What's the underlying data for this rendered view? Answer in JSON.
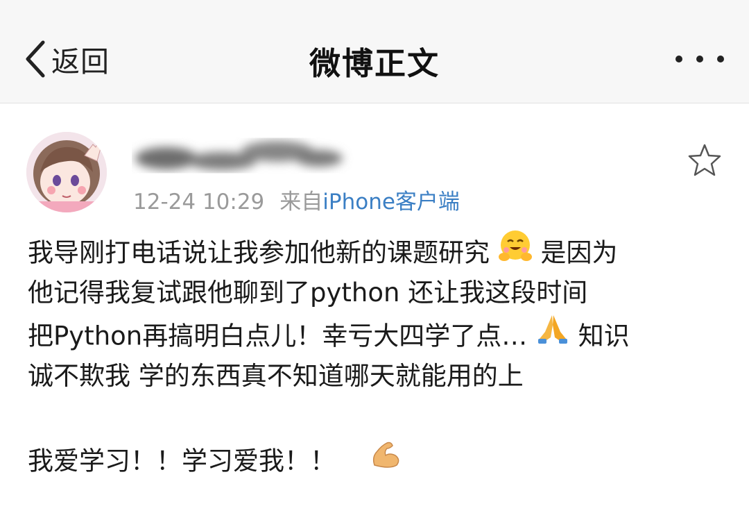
{
  "nav": {
    "back_label": "返回",
    "title": "微博正文"
  },
  "post": {
    "time": "12-24 10:29",
    "source_prefix": "来自",
    "source_link": "iPhone客户端",
    "lines": [
      [
        "我导刚打电话说让我参加他新的课题研究",
        "是因为"
      ],
      [
        "他记得我复试跟他聊到了python  还让我这段时间"
      ],
      [
        "把Python再搞明白点儿！幸亏大四学了点…",
        "知识"
      ],
      [
        "诚不欺我  学的东西真不知道哪天就能用的上"
      ],
      [
        "我爱学习！！学习爱我！！"
      ]
    ]
  },
  "icons": {
    "back": "chevron-left-icon",
    "more": "more-dots-icon",
    "favorite": "star-outline-icon",
    "emoji_1": "hugging-face-emoji",
    "emoji_2": "folded-hands-emoji",
    "emoji_3": "flexed-biceps-emoji"
  },
  "colors": {
    "link": "#3b7fc4",
    "meta": "#9a9a9a",
    "nav_bg": "#f7f7f7"
  }
}
